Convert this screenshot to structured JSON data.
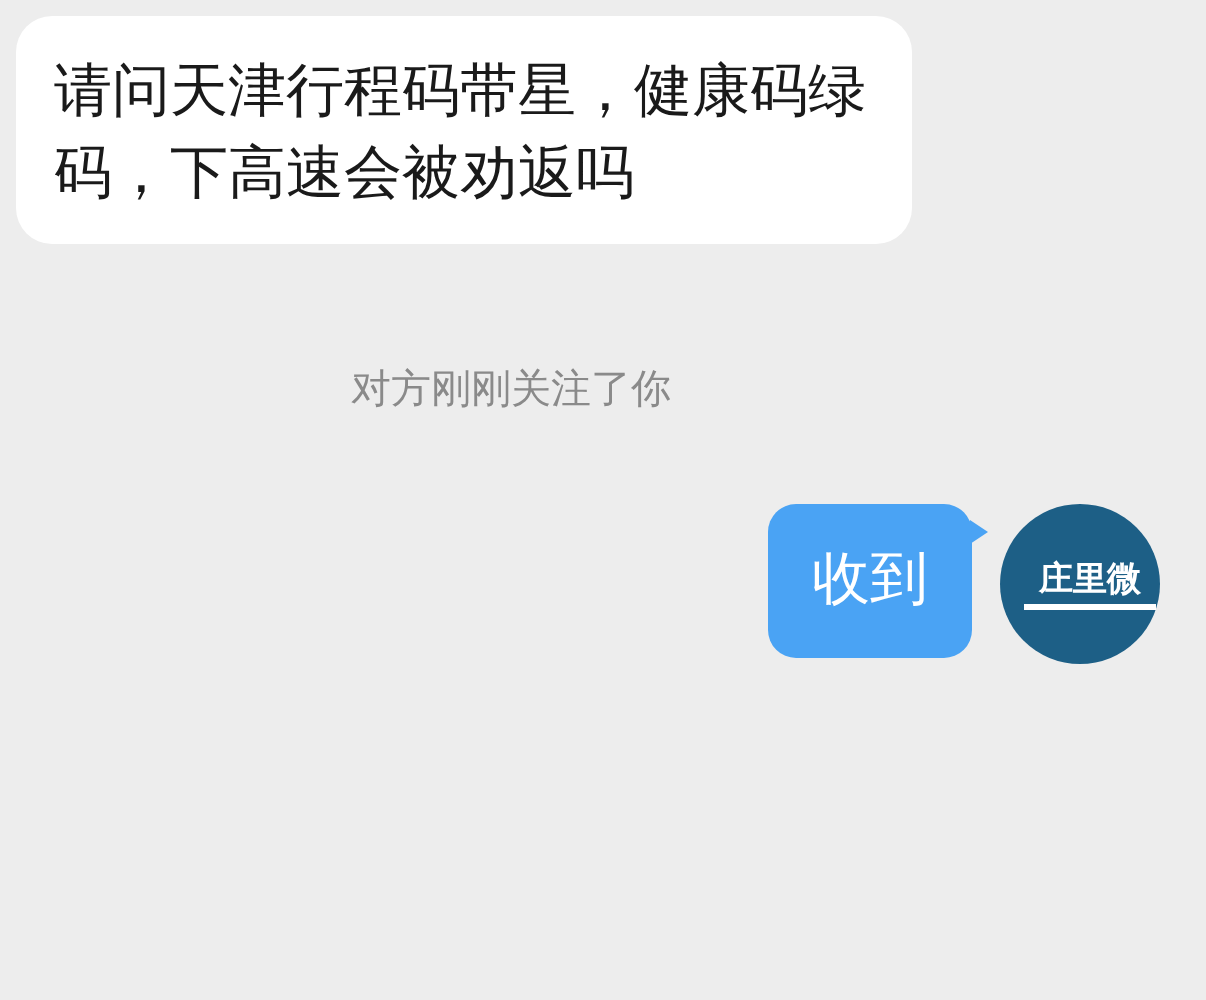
{
  "messages": [
    {
      "kind": "incoming",
      "text": "请问天津行程码带星，健康码绿码，下高速会被劝返吗"
    },
    {
      "kind": "notice",
      "text": "对方刚刚关注了你"
    },
    {
      "kind": "outgoing",
      "text": "收到",
      "avatar": {
        "text": "庄里微"
      }
    }
  ]
}
